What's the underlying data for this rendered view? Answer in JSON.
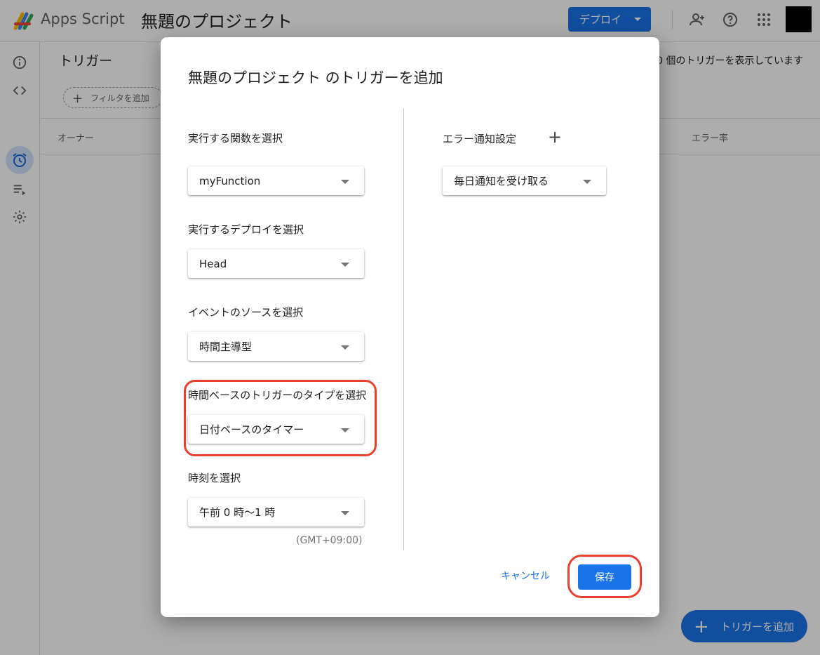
{
  "app": {
    "name": "Apps Script",
    "project_name": "無題のプロジェクト",
    "deploy_label": "デプロイ"
  },
  "main": {
    "title": "トリガー",
    "trigger_count_text": "0 個のトリガーを表示しています",
    "filter_label": "フィルタを追加",
    "columns": {
      "owner": "オーナー",
      "error_rate": "エラー率"
    },
    "fab_label": "トリガーを追加"
  },
  "dialog": {
    "title": "無題のプロジェクト のトリガーを追加",
    "function": {
      "label": "実行する関数を選択",
      "value": "myFunction"
    },
    "deployment": {
      "label": "実行するデプロイを選択",
      "value": "Head"
    },
    "event_source": {
      "label": "イベントのソースを選択",
      "value": "時間主導型"
    },
    "time_trigger_type": {
      "label": "時間ベースのトリガーのタイプを選択",
      "value": "日付ベースのタイマー"
    },
    "time_of_day": {
      "label": "時刻を選択",
      "value": "午前 0 時〜1 時",
      "timezone": "(GMT+09:00)"
    },
    "error_notification": {
      "label": "エラー通知設定",
      "value": "毎日通知を受け取る"
    },
    "cancel_label": "キャンセル",
    "save_label": "保存"
  },
  "colors": {
    "accent": "#1a73e8",
    "highlight": "#e8402e",
    "scrim": "rgba(0,0,0,0.32)"
  }
}
